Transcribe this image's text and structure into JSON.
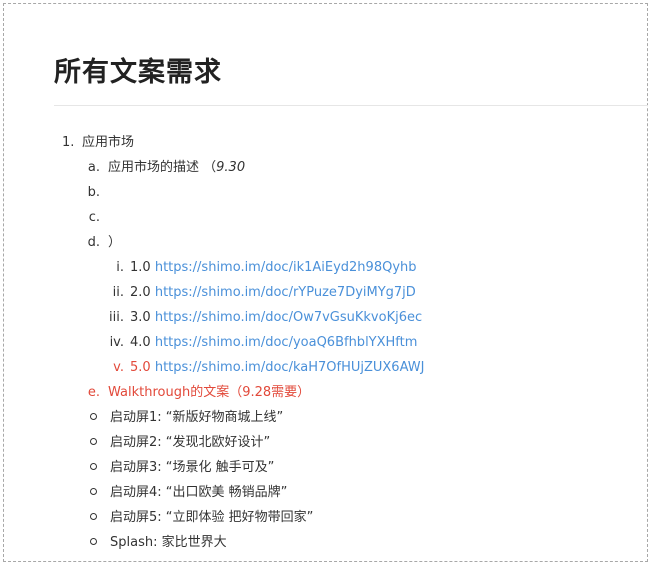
{
  "page_title": "所有文案需求",
  "list": {
    "item1": {
      "marker": "1.",
      "text": "应用市场"
    },
    "sub": [
      {
        "marker": "a.",
        "text": "应用市场的描述 （",
        "extra": "9.30"
      },
      {
        "marker": "b.",
        "text": ""
      },
      {
        "marker": "c.",
        "text": ""
      },
      {
        "marker": "d.",
        "text": "）"
      }
    ],
    "versions": [
      {
        "marker": "i.",
        "version": "1.0",
        "url": "https://shimo.im/doc/ik1AiEyd2h98Qyhb"
      },
      {
        "marker": "ii.",
        "version": "2.0",
        "url": "https://shimo.im/doc/rYPuze7DyiMYg7jD"
      },
      {
        "marker": "iii.",
        "version": "3.0",
        "url": "https://shimo.im/doc/Ow7vGsuKkvoKj6ec"
      },
      {
        "marker": "iv.",
        "version": "4.0",
        "url": "https://shimo.im/doc/yoaQ6BfhblYXHftm"
      },
      {
        "marker": "v.",
        "version": "5.0",
        "url": "https://shimo.im/doc/kaH7OfHUjZUX6AWJ"
      }
    ],
    "walkthrough": {
      "marker": "e.",
      "text": "Walkthrough的文案（9.28需要）"
    },
    "bullets": [
      "启动屏1: “新版好物商城上线”",
      "启动屏2: “发现北欧好设计”",
      "启动屏3: “场景化 触手可及”",
      "启动屏4: “出口欧美 畅销品牌”",
      "启动屏5: “立即体验 把好物带回家”",
      "Splash: 家比世界大"
    ]
  },
  "colors": {
    "text": "#333333",
    "link": "#4a90d9",
    "highlight_red": "#e2493a",
    "border": "#a8a8a8"
  }
}
